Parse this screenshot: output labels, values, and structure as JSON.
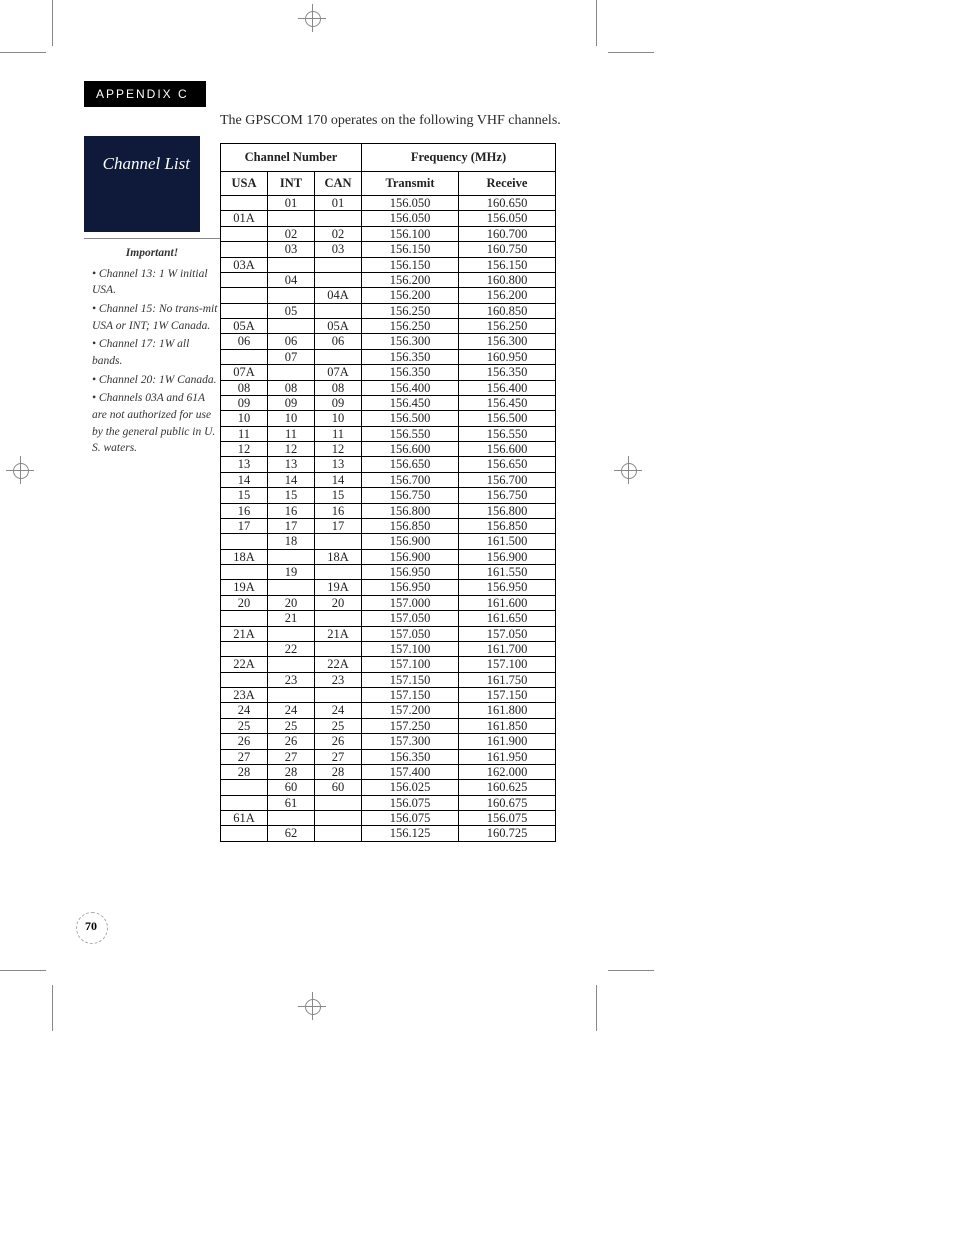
{
  "appendix_label": "APPENDIX  C",
  "sidebar_title": "Channel List",
  "intro_text": "The GPSCOM 170 operates on the following  VHF channels.",
  "notes_header": "Important!",
  "notes": [
    "Channel 13: 1 W initial USA.",
    "Channel 15: No trans-mit USA or INT; 1W Canada.",
    "Channel 17: 1W all bands.",
    "Channel 20: 1W Canada.",
    "Channels 03A and 61A are not authorized for use by the general public in U. S. waters."
  ],
  "page_number": "70",
  "headers": {
    "chan_group": "Channel Number",
    "freq_group": "Frequency (MHz)",
    "usa": "USA",
    "int": "INT",
    "can": "CAN",
    "tx": "Transmit",
    "rx": "Receive"
  },
  "chart_data": {
    "type": "table",
    "columns": [
      "USA",
      "INT",
      "CAN",
      "Transmit",
      "Receive"
    ],
    "rows": [
      [
        "",
        "01",
        "01",
        "156.050",
        "160.650"
      ],
      [
        "01A",
        "",
        "",
        "156.050",
        "156.050"
      ],
      [
        "",
        "02",
        "02",
        "156.100",
        "160.700"
      ],
      [
        "",
        "03",
        "03",
        "156.150",
        "160.750"
      ],
      [
        "03A",
        "",
        "",
        "156.150",
        "156.150"
      ],
      [
        "",
        "04",
        "",
        "156.200",
        "160.800"
      ],
      [
        "",
        "",
        "04A",
        "156.200",
        "156.200"
      ],
      [
        "",
        "05",
        "",
        "156.250",
        "160.850"
      ],
      [
        "05A",
        "",
        "05A",
        "156.250",
        "156.250"
      ],
      [
        "06",
        "06",
        "06",
        "156.300",
        "156.300"
      ],
      [
        "",
        "07",
        "",
        "156.350",
        "160.950"
      ],
      [
        "07A",
        "",
        "07A",
        "156.350",
        "156.350"
      ],
      [
        "08",
        "08",
        "08",
        "156.400",
        "156.400"
      ],
      [
        "09",
        "09",
        "09",
        "156.450",
        "156.450"
      ],
      [
        "10",
        "10",
        "10",
        "156.500",
        "156.500"
      ],
      [
        "11",
        "11",
        "11",
        "156.550",
        "156.550"
      ],
      [
        "12",
        "12",
        "12",
        "156.600",
        "156.600"
      ],
      [
        "13",
        "13",
        "13",
        "156.650",
        "156.650"
      ],
      [
        "14",
        "14",
        "14",
        "156.700",
        "156.700"
      ],
      [
        "15",
        "15",
        "15",
        "156.750",
        "156.750"
      ],
      [
        "16",
        "16",
        "16",
        "156.800",
        "156.800"
      ],
      [
        "17",
        "17",
        "17",
        "156.850",
        "156.850"
      ],
      [
        "",
        "18",
        "",
        "156.900",
        "161.500"
      ],
      [
        "18A",
        "",
        "18A",
        "156.900",
        "156.900"
      ],
      [
        "",
        "19",
        "",
        "156.950",
        "161.550"
      ],
      [
        "19A",
        "",
        "19A",
        "156.950",
        "156.950"
      ],
      [
        "20",
        "20",
        "20",
        "157.000",
        "161.600"
      ],
      [
        "",
        "21",
        "",
        "157.050",
        "161.650"
      ],
      [
        "21A",
        "",
        "21A",
        "157.050",
        "157.050"
      ],
      [
        "",
        "22",
        "",
        "157.100",
        "161.700"
      ],
      [
        "22A",
        "",
        "22A",
        "157.100",
        "157.100"
      ],
      [
        "",
        "23",
        "23",
        "157.150",
        "161.750"
      ],
      [
        "23A",
        "",
        "",
        "157.150",
        "157.150"
      ],
      [
        "24",
        "24",
        "24",
        "157.200",
        "161.800"
      ],
      [
        "25",
        "25",
        "25",
        "157.250",
        "161.850"
      ],
      [
        "26",
        "26",
        "26",
        "157.300",
        "161.900"
      ],
      [
        "27",
        "27",
        "27",
        "156.350",
        "161.950"
      ],
      [
        "28",
        "28",
        "28",
        "157.400",
        "162.000"
      ],
      [
        "",
        "60",
        "60",
        "156.025",
        "160.625"
      ],
      [
        "",
        "61",
        "",
        "156.075",
        "160.675"
      ],
      [
        "61A",
        "",
        "",
        "156.075",
        "156.075"
      ],
      [
        "",
        "62",
        "",
        "156.125",
        "160.725"
      ]
    ]
  }
}
